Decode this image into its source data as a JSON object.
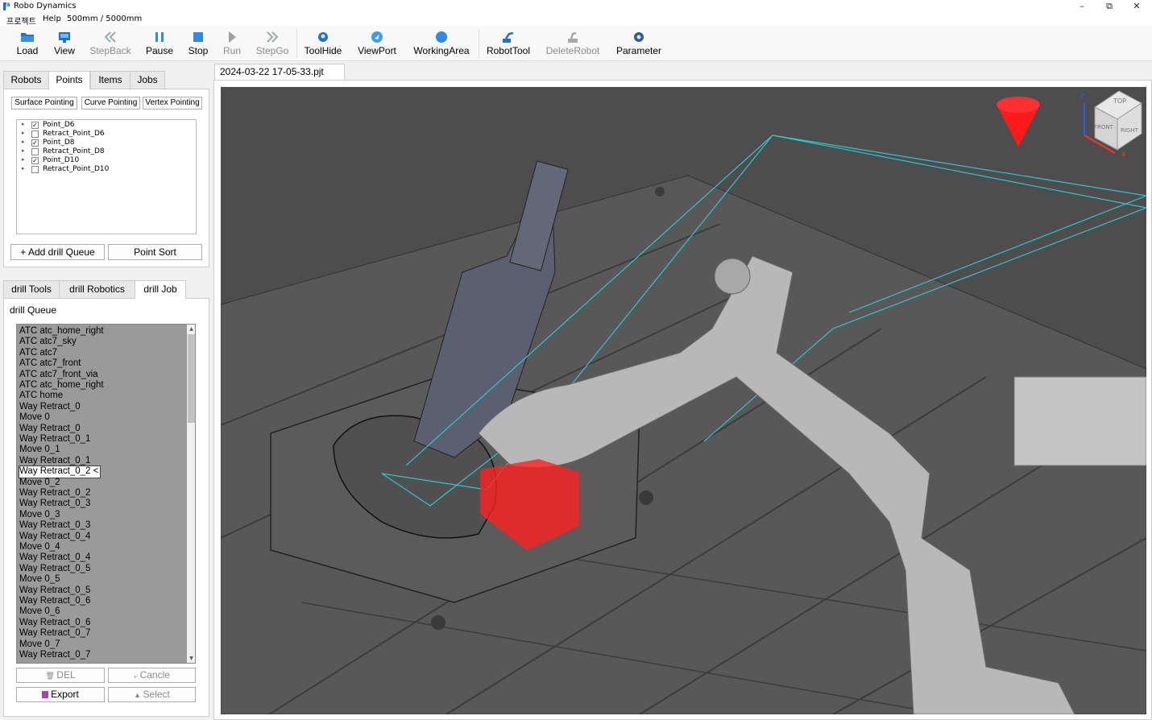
{
  "window": {
    "title": "Robo Dynamics",
    "minimize": "–",
    "maximize": "⧉",
    "close": "✕"
  },
  "menu": {
    "project": "프로젝트",
    "help": "Help",
    "range": "500mm / 5000mm"
  },
  "toolbar": {
    "load": "Load",
    "view": "View",
    "stepback": "StepBack",
    "pause": "Pause",
    "stop": "Stop",
    "run": "Run",
    "stepgo": "StepGo",
    "toolhide": "ToolHide",
    "viewport": "ViewPort",
    "workingarea": "WorkingArea",
    "robottool": "RobotTool",
    "deleterobot": "DeleteRobot",
    "parameter": "Parameter"
  },
  "top_tabs": [
    "Robots",
    "Points",
    "Items",
    "Jobs"
  ],
  "points": {
    "surface": "Surface Pointing",
    "curve": "Curve Pointing",
    "vertex": "Vertex Pointing",
    "items": [
      {
        "label": "Point_D6",
        "checked": "✓"
      },
      {
        "label": "Retract_Point_D6",
        "checked": ""
      },
      {
        "label": "Point_D8",
        "checked": "✓"
      },
      {
        "label": "Retract_Point_D8",
        "checked": ""
      },
      {
        "label": "Point_D10",
        "checked": "✓"
      },
      {
        "label": "Retract_Point_D10",
        "checked": ""
      }
    ],
    "add_queue": "+ Add drill Queue",
    "sort": "Point Sort"
  },
  "bottom_tabs": [
    "drill Tools",
    "drill Robotics",
    "drill Job"
  ],
  "queue": {
    "title": "drill Queue",
    "items": [
      "ATC atc_home_right",
      "ATC atc7_sky",
      "ATC atc7",
      "ATC atc7_front",
      "ATC atc7_front_via",
      "ATC atc_home_right",
      "ATC home",
      "Way Retract_0",
      "Move 0",
      "Way Retract_0",
      "Way Retract_0_1",
      "Move 0_1",
      "Way Retract_0_1",
      "Way Retract_0_2 <",
      "Move 0_2",
      "Way Retract_0_2",
      "Way Retract_0_3",
      "Move 0_3",
      "Way Retract_0_3",
      "Way Retract_0_4",
      "Move 0_4",
      "Way Retract_0_4",
      "Way Retract_0_5",
      "Move 0_5",
      "Way Retract_0_5",
      "Way Retract_0_6",
      "Move 0_6",
      "Way Retract_0_6",
      "Way Retract_0_7",
      "Move 0_7",
      "Way Retract_0_7"
    ],
    "selected_index": 13,
    "del": "DEL",
    "cancel": "Cancle",
    "export": "Export",
    "select": "Select"
  },
  "document": {
    "tab": "2024-03-22 17-05-33.pjt"
  },
  "viewcube": {
    "top": "TOP",
    "front": "FRONT",
    "right": "RIGHT",
    "axis_z": "Z",
    "axis_x": "X"
  },
  "colors": {
    "viewport_bg": "#4a4a4a",
    "path": "#2cc8d0",
    "highlight": "#ff2020",
    "robot": "#b8b8b8"
  }
}
